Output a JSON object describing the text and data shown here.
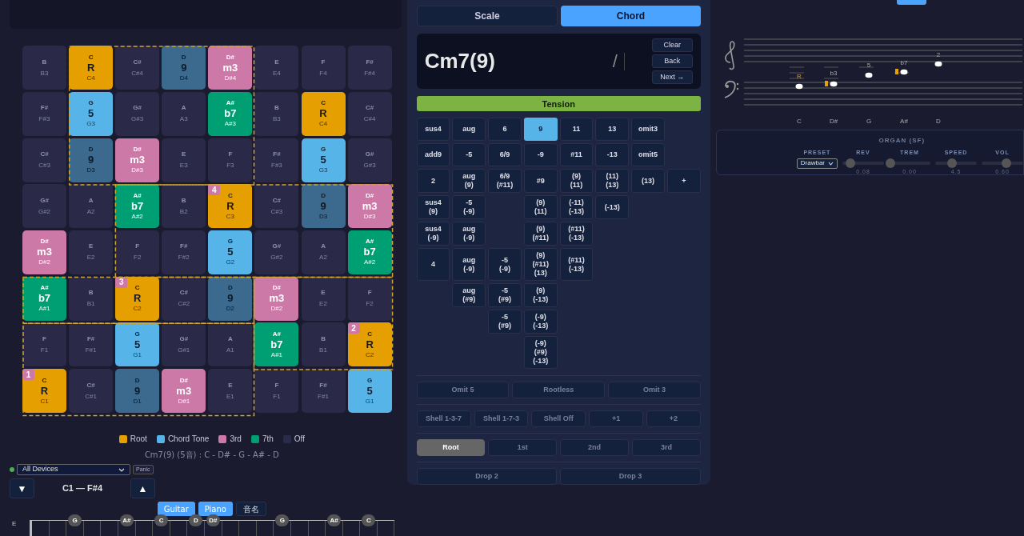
{
  "grid": {
    "rows": [
      [
        {
          "note": "B",
          "octave": "B3",
          "kind": "off"
        },
        {
          "note": "C",
          "degree": "R",
          "octave": "C4",
          "kind": "root"
        },
        {
          "note": "C#",
          "octave": "C#4",
          "kind": "off"
        },
        {
          "note": "D",
          "degree": "9",
          "octave": "D4",
          "kind": "ninth"
        },
        {
          "note": "D#",
          "degree": "m3",
          "octave": "D#4",
          "kind": "third"
        },
        {
          "note": "E",
          "octave": "E4",
          "kind": "off"
        },
        {
          "note": "F",
          "octave": "F4",
          "kind": "off"
        },
        {
          "note": "F#",
          "octave": "F#4",
          "kind": "off"
        }
      ],
      [
        {
          "note": "F#",
          "octave": "F#3",
          "kind": "off"
        },
        {
          "note": "G",
          "degree": "5",
          "octave": "G3",
          "kind": "fifth"
        },
        {
          "note": "G#",
          "octave": "G#3",
          "kind": "off"
        },
        {
          "note": "A",
          "octave": "A3",
          "kind": "off"
        },
        {
          "note": "A#",
          "degree": "b7",
          "octave": "A#3",
          "kind": "seventh"
        },
        {
          "note": "B",
          "octave": "B3",
          "kind": "off"
        },
        {
          "note": "C",
          "degree": "R",
          "octave": "C4",
          "kind": "root"
        },
        {
          "note": "C#",
          "octave": "C#4",
          "kind": "off"
        }
      ],
      [
        {
          "note": "C#",
          "octave": "C#3",
          "kind": "off"
        },
        {
          "note": "D",
          "degree": "9",
          "octave": "D3",
          "kind": "ninth"
        },
        {
          "note": "D#",
          "degree": "m3",
          "octave": "D#3",
          "kind": "third"
        },
        {
          "note": "E",
          "octave": "E3",
          "kind": "off"
        },
        {
          "note": "F",
          "octave": "F3",
          "kind": "off"
        },
        {
          "note": "F#",
          "octave": "F#3",
          "kind": "off"
        },
        {
          "note": "G",
          "degree": "5",
          "octave": "G3",
          "kind": "fifth"
        },
        {
          "note": "G#",
          "octave": "G#3",
          "kind": "off"
        }
      ],
      [
        {
          "note": "G#",
          "octave": "G#2",
          "kind": "off"
        },
        {
          "note": "A",
          "octave": "A2",
          "kind": "off"
        },
        {
          "note": "A#",
          "degree": "b7",
          "octave": "A#2",
          "kind": "seventh"
        },
        {
          "note": "B",
          "octave": "B2",
          "kind": "off"
        },
        {
          "note": "C",
          "degree": "R",
          "octave": "C3",
          "kind": "root",
          "badge": "4"
        },
        {
          "note": "C#",
          "octave": "C#3",
          "kind": "off"
        },
        {
          "note": "D",
          "degree": "9",
          "octave": "D3",
          "kind": "ninth"
        },
        {
          "note": "D#",
          "degree": "m3",
          "octave": "D#3",
          "kind": "third"
        }
      ],
      [
        {
          "note": "D#",
          "degree": "m3",
          "octave": "D#2",
          "kind": "third"
        },
        {
          "note": "E",
          "octave": "E2",
          "kind": "off"
        },
        {
          "note": "F",
          "octave": "F2",
          "kind": "off"
        },
        {
          "note": "F#",
          "octave": "F#2",
          "kind": "off"
        },
        {
          "note": "G",
          "degree": "5",
          "octave": "G2",
          "kind": "fifth"
        },
        {
          "note": "G#",
          "octave": "G#2",
          "kind": "off"
        },
        {
          "note": "A",
          "octave": "A2",
          "kind": "off"
        },
        {
          "note": "A#",
          "degree": "b7",
          "octave": "A#2",
          "kind": "seventh"
        }
      ],
      [
        {
          "note": "A#",
          "degree": "b7",
          "octave": "A#1",
          "kind": "seventh"
        },
        {
          "note": "B",
          "octave": "B1",
          "kind": "off"
        },
        {
          "note": "C",
          "degree": "R",
          "octave": "C2",
          "kind": "root",
          "badge": "3"
        },
        {
          "note": "C#",
          "octave": "C#2",
          "kind": "off"
        },
        {
          "note": "D",
          "degree": "9",
          "octave": "D2",
          "kind": "ninth"
        },
        {
          "note": "D#",
          "degree": "m3",
          "octave": "D#2",
          "kind": "third"
        },
        {
          "note": "E",
          "octave": "E2",
          "kind": "off"
        },
        {
          "note": "F",
          "octave": "F2",
          "kind": "off"
        }
      ],
      [
        {
          "note": "F",
          "octave": "F1",
          "kind": "off"
        },
        {
          "note": "F#",
          "octave": "F#1",
          "kind": "off"
        },
        {
          "note": "G",
          "degree": "5",
          "octave": "G1",
          "kind": "fifth"
        },
        {
          "note": "G#",
          "octave": "G#1",
          "kind": "off"
        },
        {
          "note": "A",
          "octave": "A1",
          "kind": "off"
        },
        {
          "note": "A#",
          "degree": "b7",
          "octave": "A#1",
          "kind": "seventh"
        },
        {
          "note": "B",
          "octave": "B1",
          "kind": "off"
        },
        {
          "note": "C",
          "degree": "R",
          "octave": "C2",
          "kind": "root",
          "badge": "2"
        }
      ],
      [
        {
          "note": "C",
          "degree": "R",
          "octave": "C1",
          "kind": "root",
          "badge": "1"
        },
        {
          "note": "C#",
          "octave": "C#1",
          "kind": "off"
        },
        {
          "note": "D",
          "degree": "9",
          "octave": "D1",
          "kind": "ninth"
        },
        {
          "note": "D#",
          "degree": "m3",
          "octave": "D#1",
          "kind": "third"
        },
        {
          "note": "E",
          "octave": "E1",
          "kind": "off"
        },
        {
          "note": "F",
          "octave": "F1",
          "kind": "off"
        },
        {
          "note": "F#",
          "octave": "F#1",
          "kind": "off"
        },
        {
          "note": "G",
          "degree": "5",
          "octave": "G1",
          "kind": "fifth"
        }
      ]
    ]
  },
  "legend": [
    {
      "label": "Root",
      "color": "#e69f00"
    },
    {
      "label": "Chord Tone",
      "color": "#56b4e9"
    },
    {
      "label": "3rd",
      "color": "#cc79a7"
    },
    {
      "label": "7th",
      "color": "#009e73"
    },
    {
      "label": "Off",
      "color": "#2a2a4a"
    }
  ],
  "summary": "Cm7(9) (5音) : C - D# - G - A# - D",
  "midi": {
    "connected": true,
    "device": "All Devices",
    "panic": "Panic"
  },
  "range": {
    "down": "▼",
    "label": "C1 — F#4",
    "up": "▲"
  },
  "view_toggles": [
    {
      "label": "Guitar",
      "selected": true
    },
    {
      "label": "Piano",
      "selected": true
    },
    {
      "label": "音名",
      "selected": false
    }
  ],
  "fretboard": {
    "string": "E",
    "frets": [
      {
        "kind": "empty"
      },
      {
        "kind": "empty"
      },
      {
        "kind": "dot",
        "note": "G"
      },
      {
        "kind": "empty"
      },
      {
        "kind": "empty"
      },
      {
        "kind": "dot",
        "note": "A#"
      },
      {
        "kind": "empty"
      },
      {
        "kind": "dot",
        "note": "C"
      },
      {
        "kind": "empty"
      },
      {
        "kind": "dot",
        "note": "D"
      },
      {
        "kind": "dot",
        "note": "D#"
      },
      {
        "kind": "empty"
      },
      {
        "kind": "empty"
      },
      {
        "kind": "empty"
      },
      {
        "kind": "dot",
        "note": "G"
      },
      {
        "kind": "empty"
      },
      {
        "kind": "empty"
      },
      {
        "kind": "dot",
        "note": "A#"
      },
      {
        "kind": "empty"
      },
      {
        "kind": "dot",
        "note": "C"
      },
      {
        "kind": "empty"
      }
    ]
  },
  "mode_tabs": [
    {
      "label": "Scale",
      "selected": false
    },
    {
      "label": "Chord",
      "selected": true
    }
  ],
  "chord_input": {
    "value": "Cm7(9)",
    "slash": "/",
    "buttons": [
      "Clear",
      "Back",
      "Next →"
    ]
  },
  "tension": {
    "title": "Tension",
    "rows": [
      [
        {
          "kind": "button",
          "label": "sus4",
          "selected": false
        },
        {
          "kind": "button",
          "label": "aug",
          "selected": false
        },
        {
          "kind": "button",
          "label": "6",
          "selected": false
        },
        {
          "kind": "button",
          "label": "9",
          "selected": true
        },
        {
          "kind": "button",
          "label": "11",
          "selected": false
        },
        {
          "kind": "button",
          "label": "13",
          "selected": false
        },
        {
          "kind": "button",
          "label": "omit3",
          "selected": false
        }
      ],
      [
        {
          "kind": "button",
          "label": "add9",
          "selected": false
        },
        {
          "kind": "button",
          "label": "-5",
          "selected": false
        },
        {
          "kind": "button",
          "label": "6/9",
          "selected": false
        },
        {
          "kind": "button",
          "label": "-9",
          "selected": false
        },
        {
          "kind": "button",
          "label": "#11",
          "selected": false
        },
        {
          "kind": "button",
          "label": "-13",
          "selected": false
        },
        {
          "kind": "button",
          "label": "omit5",
          "selected": false
        }
      ],
      [
        {
          "kind": "button",
          "label": "2",
          "selected": false
        },
        {
          "kind": "button",
          "label": "aug\n(9)",
          "selected": false
        },
        {
          "kind": "button",
          "label": "6/9\n(#11)",
          "selected": false
        },
        {
          "kind": "button",
          "label": "#9",
          "selected": false
        },
        {
          "kind": "button",
          "label": "(9)\n(11)",
          "selected": false
        },
        {
          "kind": "button",
          "label": "(11)\n(13)",
          "selected": false
        },
        {
          "kind": "button",
          "label": "(13)",
          "selected": false
        },
        {
          "kind": "button",
          "label": "+",
          "selected": false
        }
      ],
      [
        {
          "kind": "button",
          "label": "sus4\n(9)",
          "selected": false
        },
        {
          "kind": "button",
          "label": "-5\n(-9)",
          "selected": false
        },
        {
          "kind": "blank"
        },
        {
          "kind": "button",
          "label": "(9)\n(11)",
          "selected": false
        },
        {
          "kind": "button",
          "label": "(-11)\n(-13)",
          "selected": false
        },
        {
          "kind": "button",
          "label": "(-13)",
          "selected": false
        }
      ],
      [
        {
          "kind": "button",
          "label": "sus4\n(-9)",
          "selected": false
        },
        {
          "kind": "button",
          "label": "aug\n(-9)",
          "selected": false
        },
        {
          "kind": "blank"
        },
        {
          "kind": "button",
          "label": "(9)\n(#11)",
          "selected": false
        },
        {
          "kind": "button",
          "label": "(#11)\n(-13)",
          "selected": false
        }
      ],
      [
        {
          "kind": "button",
          "label": "4",
          "selected": false
        },
        {
          "kind": "button",
          "label": "aug\n(-9)",
          "selected": false
        },
        {
          "kind": "button",
          "label": "-5\n(-9)",
          "selected": false
        },
        {
          "kind": "button",
          "label": "(9)\n(#11)\n(13)",
          "selected": false
        },
        {
          "kind": "button",
          "label": "(#11)\n(-13)",
          "selected": false
        }
      ],
      [
        {
          "kind": "blank"
        },
        {
          "kind": "button",
          "label": "aug\n(#9)",
          "selected": false
        },
        {
          "kind": "button",
          "label": "-5\n(#9)",
          "selected": false
        },
        {
          "kind": "button",
          "label": "(9)\n(-13)",
          "selected": false
        }
      ],
      [
        {
          "kind": "blank"
        },
        {
          "kind": "blank"
        },
        {
          "kind": "button",
          "label": "-5\n(#9)",
          "selected": false
        },
        {
          "kind": "button",
          "label": "(-9)\n(-13)",
          "selected": false
        }
      ],
      [
        {
          "kind": "blank"
        },
        {
          "kind": "blank"
        },
        {
          "kind": "blank"
        },
        {
          "kind": "button",
          "label": "(-9)\n(#9)\n(-13)",
          "selected": false
        }
      ]
    ]
  },
  "omit": [
    "Omit 5",
    "Rootless",
    "Omit 3"
  ],
  "shell": [
    "Shell 1-3-7",
    "Shell 1-7-3",
    "Shell Off",
    "+1",
    "+2"
  ],
  "inversions": [
    {
      "label": "Root",
      "selected": true
    },
    {
      "label": "1st",
      "selected": false
    },
    {
      "label": "2nd",
      "selected": false
    },
    {
      "label": "3rd",
      "selected": false
    }
  ],
  "drop": [
    "Drop 2",
    "Drop 3"
  ],
  "staff": {
    "notes": [
      {
        "label": "R",
        "name": "C",
        "root": true,
        "sharp": false
      },
      {
        "label": "b3",
        "name": "D#",
        "root": false,
        "sharp": true
      },
      {
        "label": "5",
        "name": "G",
        "root": false,
        "sharp": false
      },
      {
        "label": "b7",
        "name": "A#",
        "root": false,
        "sharp": true
      },
      {
        "label": "2",
        "name": "D",
        "root": false,
        "sharp": false
      }
    ]
  },
  "organ": {
    "title": "ORGAN (SF)",
    "preset_label": "PRESET",
    "preset": "Drawbar",
    "sliders": [
      {
        "label": "REV",
        "value": "0.08",
        "level": 0.2
      },
      {
        "label": "TREM",
        "value": "0.00",
        "level": 0.03
      },
      {
        "label": "SPEED",
        "value": "4.5",
        "level": 0.4
      },
      {
        "label": "VOL",
        "value": "0.60",
        "level": 0.6
      }
    ]
  }
}
